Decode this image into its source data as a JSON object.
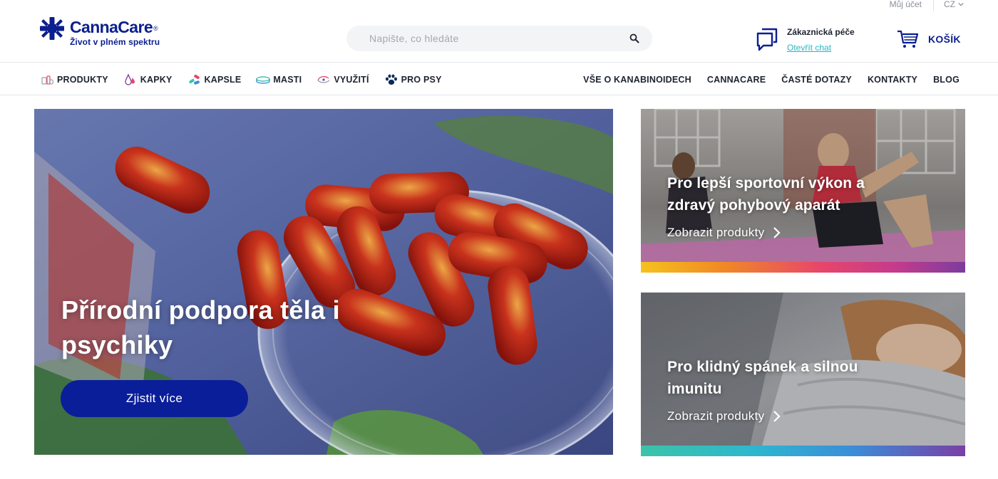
{
  "header": {
    "account_label": "Můj účet",
    "language": "CZ",
    "logo": {
      "name": "CannaCare",
      "registered": "®",
      "tagline": "Život v plném spektru"
    },
    "search": {
      "placeholder": "Napište, co hledáte",
      "value": ""
    },
    "care": {
      "title": "Zákaznická péče",
      "link": "Otevřít chat"
    },
    "cart": {
      "label": "KOŠÍK"
    }
  },
  "nav": {
    "left": [
      {
        "label": "PRODUKTY",
        "icon": "products-icon"
      },
      {
        "label": "KAPKY",
        "icon": "drops-icon"
      },
      {
        "label": "KAPSLE",
        "icon": "capsules-icon"
      },
      {
        "label": "MASTI",
        "icon": "ointment-icon"
      },
      {
        "label": "VYUŽITÍ",
        "icon": "usage-icon"
      },
      {
        "label": "PRO PSY",
        "icon": "paw-icon"
      }
    ],
    "right": [
      {
        "label": "VŠE O KANABINOIDECH"
      },
      {
        "label": "CANNACARE"
      },
      {
        "label": "ČASTÉ DOTAZY"
      },
      {
        "label": "KONTAKTY"
      },
      {
        "label": "BLOG"
      }
    ]
  },
  "hero": {
    "title": "Přírodní podpora těla i psychiky",
    "button": "Zjistit více"
  },
  "promos": [
    {
      "title": "Pro lepší sportovní výkon a zdravý pohybový aparát",
      "link": "Zobrazit produkty"
    },
    {
      "title": "Pro klidný spánek a silnou imunitu",
      "link": "Zobrazit produkty"
    }
  ],
  "colors": {
    "brand": "#0b1f8f",
    "button": "#0a1e9a",
    "link": "#27b5c2",
    "text": "#1d2330"
  }
}
